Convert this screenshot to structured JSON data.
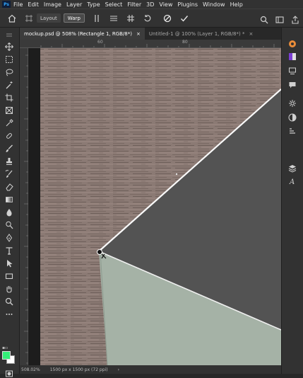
{
  "app": {
    "logo": "Ps"
  },
  "menu": [
    "File",
    "Edit",
    "Image",
    "Layer",
    "Type",
    "Select",
    "Filter",
    "3D",
    "View",
    "Plugins",
    "Window",
    "Help"
  ],
  "options_bar": {
    "layout_label": "Layout",
    "warp_label": "Warp"
  },
  "tabs": [
    {
      "label": "mockup.psd @ 508% (Rectangle 1, RGB/8*)",
      "close": "×"
    },
    {
      "label": "Untitled-1 @ 100% (Layer 1, RGB/8*) *",
      "close": "×"
    }
  ],
  "ruler": {
    "marks": [
      "60",
      "80"
    ]
  },
  "status": {
    "zoom": "508.02%",
    "doc_info": "1500 px x 1500 px (72 ppi)"
  },
  "colors": {
    "foreground": "#33ee77",
    "background": "#ffffff",
    "accent": "#31a8ff"
  },
  "icons": {
    "home": "home-icon",
    "transform": "transform-icon",
    "search": "search-icon",
    "workspace": "workspace-icon",
    "share": "share-icon"
  }
}
